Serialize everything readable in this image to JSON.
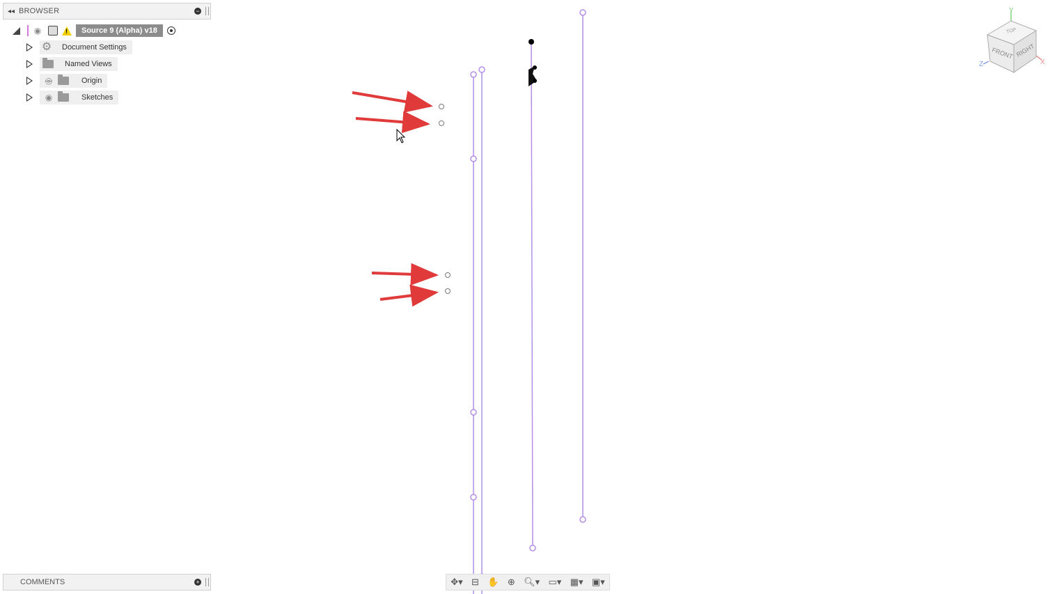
{
  "browser": {
    "title": "BROWSER",
    "root": {
      "label": "Source 9 (Alpha) v18"
    },
    "items": [
      {
        "label": "Document Settings",
        "icon": "gear-icon"
      },
      {
        "label": "Named Views",
        "icon": "folder-icon"
      },
      {
        "label": "Origin",
        "icon": "folder-icon",
        "visibility": "hidden-eye-icon"
      },
      {
        "label": "Sketches",
        "icon": "folder-icon",
        "visibility": "eye-icon"
      }
    ]
  },
  "comments": {
    "title": "COMMENTS"
  },
  "viewcube": {
    "top": "TOP",
    "front": "FRONT",
    "right": "RIGHT",
    "x": "X",
    "y": "Y",
    "z": "Z"
  },
  "colors": {
    "sketch_line": "#b48ee8",
    "annotation_arrow": "#e03a3a",
    "accent_pink": "#d877d8"
  }
}
